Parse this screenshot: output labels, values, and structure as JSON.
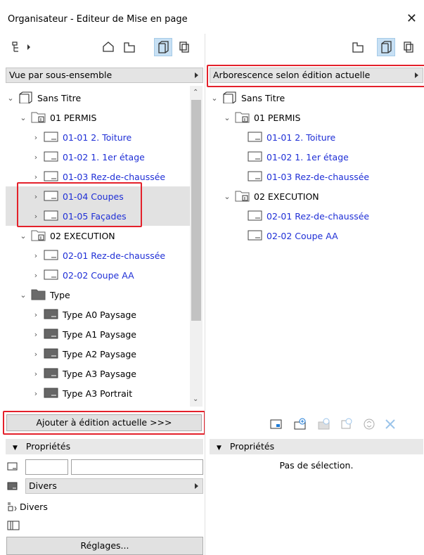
{
  "window": {
    "title": "Organisateur - Editeur de Mise en page",
    "close": "✕"
  },
  "left": {
    "view_dropdown": "Vue par sous-ensemble",
    "tree": [
      {
        "label": "Sans Titre",
        "blue": false,
        "expanded": true,
        "hl": false,
        "icon": "book"
      },
      {
        "label": "01 PERMIS",
        "blue": false,
        "expanded": true,
        "hl": false,
        "icon": "folder-sub"
      },
      {
        "label": "01-01 2. Toiture",
        "blue": true,
        "expanded": false,
        "hl": false,
        "icon": "layout"
      },
      {
        "label": "01-02 1. 1er étage",
        "blue": true,
        "expanded": false,
        "hl": false,
        "icon": "layout"
      },
      {
        "label": "01-03 Rez-de-chaussée",
        "blue": true,
        "expanded": false,
        "hl": false,
        "icon": "layout"
      },
      {
        "label": "01-04 Coupes",
        "blue": true,
        "expanded": false,
        "hl": true,
        "icon": "layout"
      },
      {
        "label": "01-05 Façades",
        "blue": true,
        "expanded": false,
        "hl": true,
        "icon": "layout"
      },
      {
        "label": "02 EXECUTION",
        "blue": false,
        "expanded": true,
        "hl": false,
        "icon": "folder-sub"
      },
      {
        "label": "02-01 Rez-de-chaussée",
        "blue": true,
        "expanded": false,
        "hl": false,
        "icon": "layout"
      },
      {
        "label": "02-02 Coupe AA",
        "blue": true,
        "expanded": false,
        "hl": false,
        "icon": "layout"
      },
      {
        "label": "Type",
        "blue": false,
        "expanded": true,
        "hl": false,
        "icon": "folder-dark"
      },
      {
        "label": "Type A0 Paysage",
        "blue": false,
        "expanded": false,
        "hl": false,
        "icon": "master"
      },
      {
        "label": "Type A1 Paysage",
        "blue": false,
        "expanded": false,
        "hl": false,
        "icon": "master"
      },
      {
        "label": "Type A2 Paysage",
        "blue": false,
        "expanded": false,
        "hl": false,
        "icon": "master"
      },
      {
        "label": "Type A3 Paysage",
        "blue": false,
        "expanded": false,
        "hl": false,
        "icon": "master"
      },
      {
        "label": "Type A3 Portrait",
        "blue": false,
        "expanded": false,
        "hl": false,
        "icon": "master"
      }
    ],
    "add_button": "Ajouter à édition actuelle >>>",
    "properties": {
      "header": "Propriétés",
      "field1_value": "",
      "field2_value": "",
      "dropdown": "Divers",
      "category": "Divers",
      "settings_button": "Réglages..."
    }
  },
  "right": {
    "view_dropdown": "Arborescence selon édition actuelle",
    "tree": [
      {
        "label": "Sans Titre",
        "blue": false,
        "expanded": true,
        "icon": "book"
      },
      {
        "label": "01 PERMIS",
        "blue": false,
        "expanded": true,
        "icon": "folder-sub"
      },
      {
        "label": "01-01 2. Toiture",
        "blue": true,
        "expanded": false,
        "icon": "layout"
      },
      {
        "label": "01-02 1. 1er étage",
        "blue": true,
        "expanded": false,
        "icon": "layout"
      },
      {
        "label": "01-03 Rez-de-chaussée",
        "blue": true,
        "expanded": false,
        "icon": "layout"
      },
      {
        "label": "02 EXECUTION",
        "blue": false,
        "expanded": true,
        "icon": "folder-sub"
      },
      {
        "label": "02-01 Rez-de-chaussée",
        "blue": true,
        "expanded": false,
        "icon": "layout"
      },
      {
        "label": "02-02 Coupe AA",
        "blue": true,
        "expanded": false,
        "icon": "layout"
      }
    ],
    "properties": {
      "header": "Propriétés",
      "empty_text": "Pas de sélection."
    }
  },
  "colors": {
    "link_blue": "#1f2fd6",
    "highlight_red": "#e4212b",
    "selected_btn": "#c7e0f4"
  }
}
